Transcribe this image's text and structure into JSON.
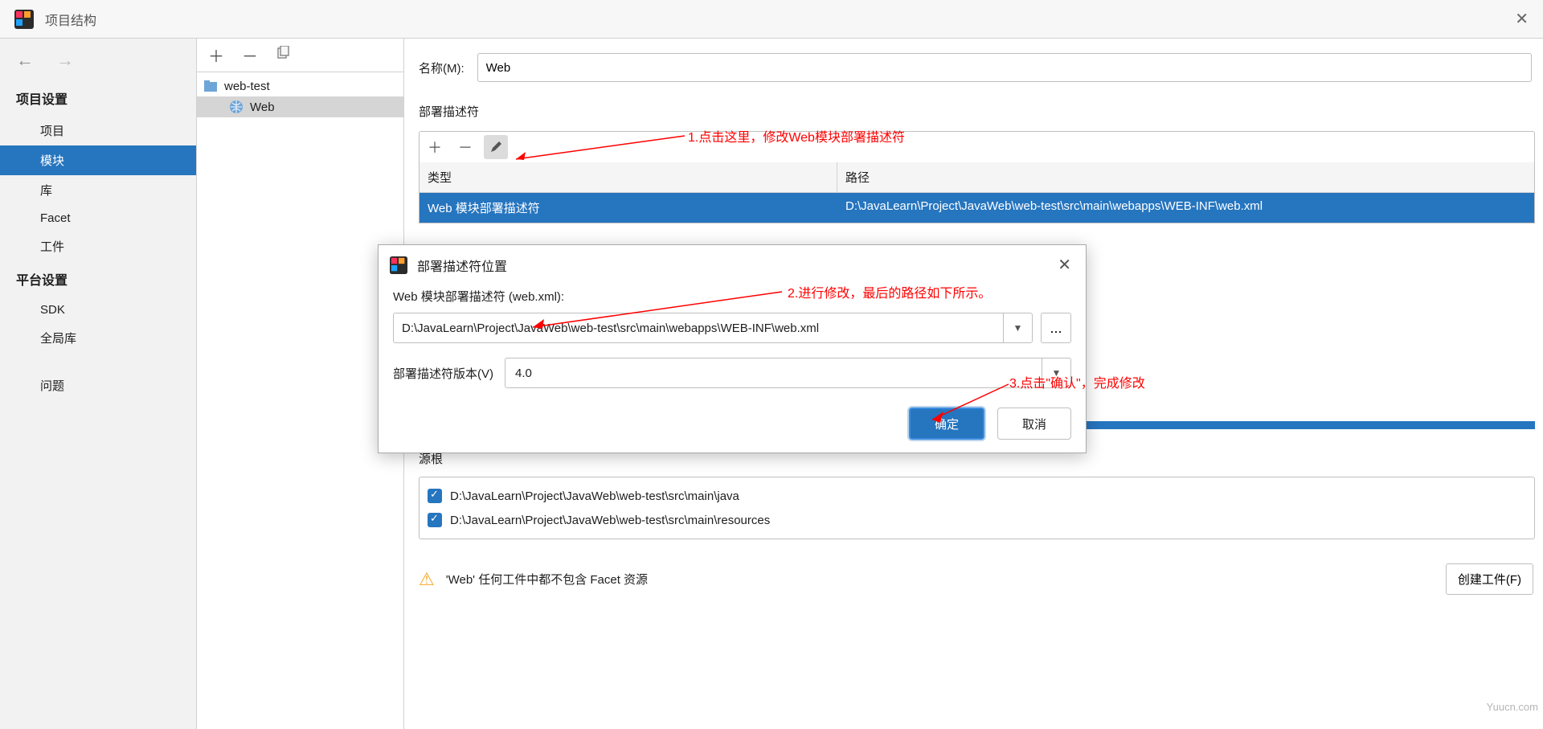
{
  "titlebar": {
    "title": "项目结构"
  },
  "sidebar": {
    "heading_project": "项目设置",
    "items_project": [
      "项目",
      "模块",
      "库",
      "Facet",
      "工件"
    ],
    "selected_project_index": 1,
    "heading_platform": "平台设置",
    "items_platform": [
      "SDK",
      "全局库"
    ],
    "problems": "问题"
  },
  "tree": {
    "root": "web-test",
    "child": "Web"
  },
  "content": {
    "name_label": "名称(M):",
    "name_value": "Web",
    "deploy_heading": "部署描述符",
    "table_type_header": "类型",
    "table_path_header": "路径",
    "row_type": "Web 模块部署描述符",
    "row_path": "D:\\JavaLearn\\Project\\JavaWeb\\web-test\\src\\main\\webapps\\WEB-INF\\web.xml",
    "src_root_heading": "源根",
    "src_roots": [
      "D:\\JavaLearn\\Project\\JavaWeb\\web-test\\src\\main\\java",
      "D:\\JavaLearn\\Project\\JavaWeb\\web-test\\src\\main\\resources"
    ],
    "warning_text": "'Web' 任何工件中都不包含 Facet 资源",
    "create_artifact_btn": "创建工件(F)"
  },
  "modal": {
    "title": "部署描述符位置",
    "body_label": "Web 模块部署描述符 (web.xml):",
    "path_value": "D:\\JavaLearn\\Project\\JavaWeb\\web-test\\src\\main\\webapps\\WEB-INF\\web.xml",
    "browse_label": "...",
    "version_label": "部署描述符版本(V)",
    "version_value": "4.0",
    "ok": "确定",
    "cancel": "取消"
  },
  "annotations": {
    "a1": "1.点击这里，修改Web模块部署描述符",
    "a2": "2.进行修改，最后的路径如下所示。",
    "a3": "3.点击\"确认\"，完成修改"
  },
  "watermark": "Yuucn.com"
}
